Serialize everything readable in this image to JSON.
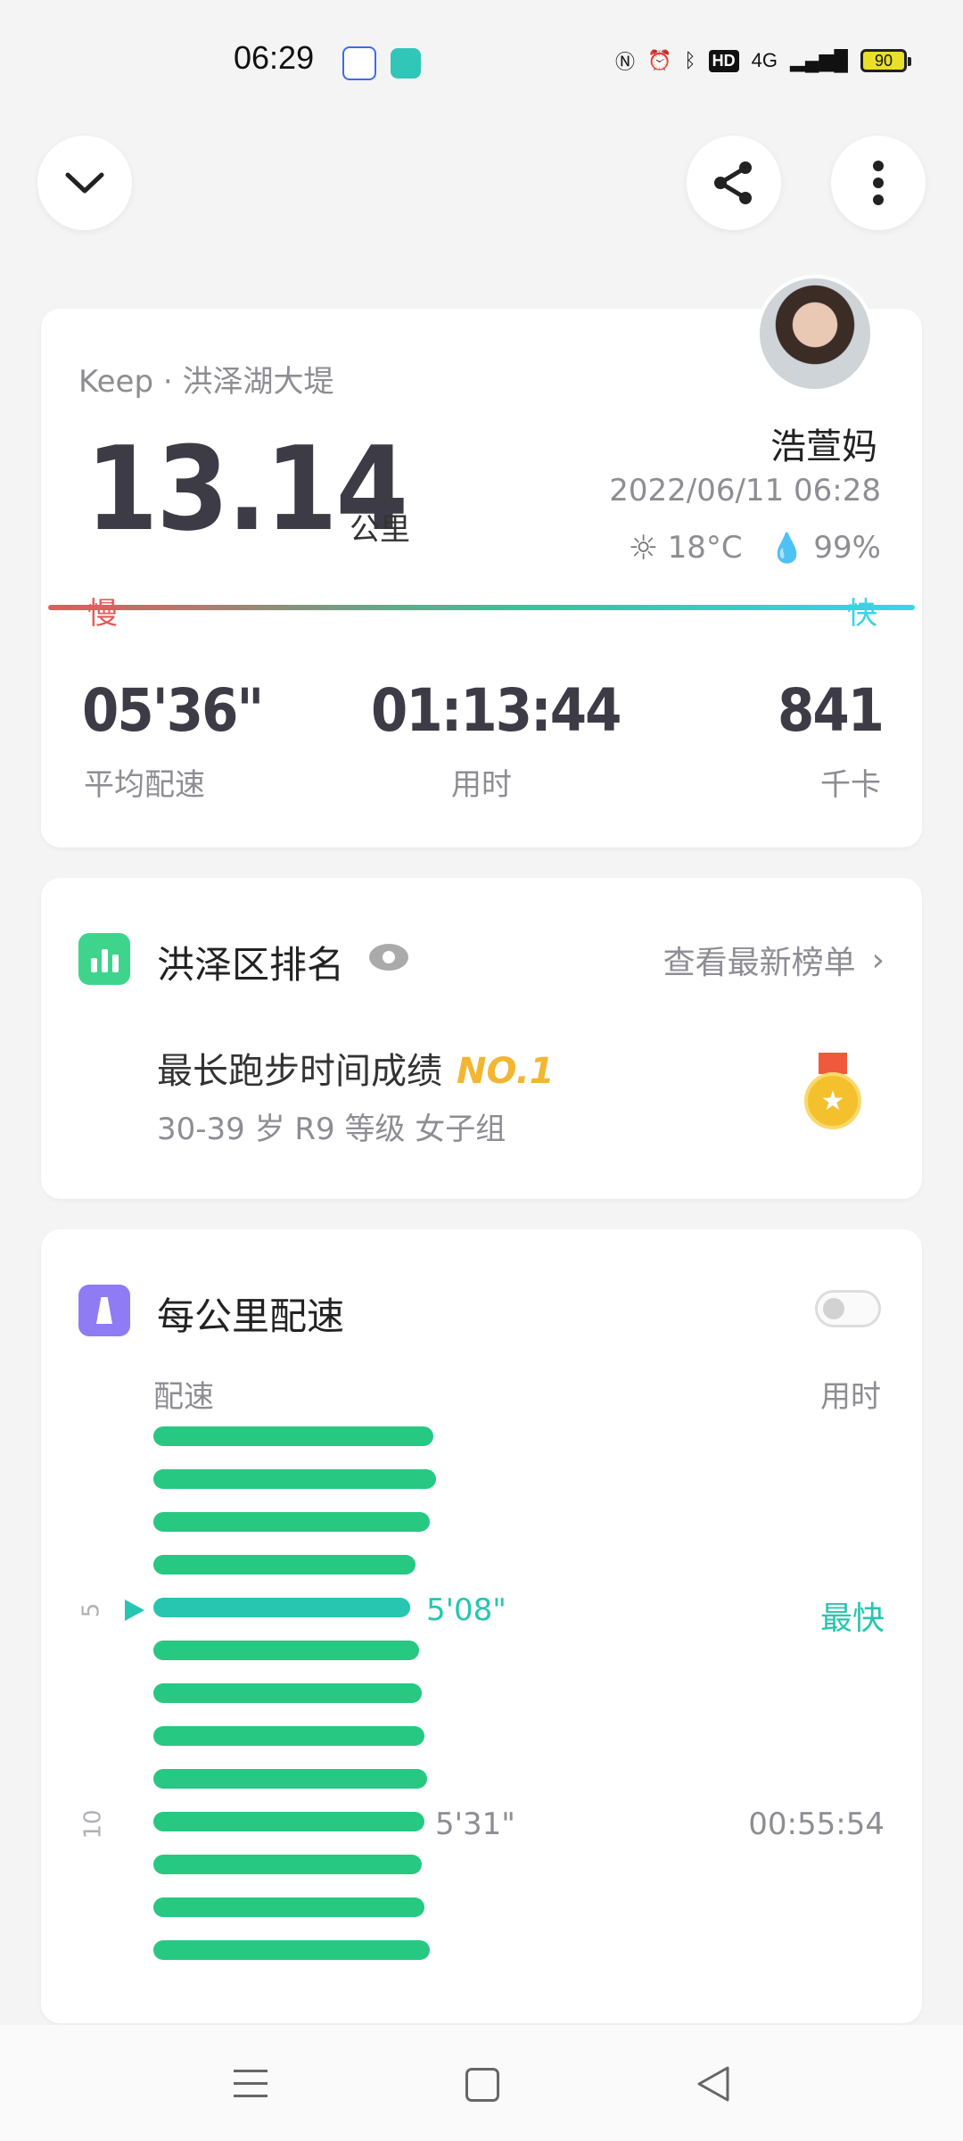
{
  "status_bar": {
    "time": "06:29",
    "network": "4G",
    "battery": "90"
  },
  "summary": {
    "source": "Keep · 洪泽湖大堤",
    "distance": "13.14",
    "distance_unit": "公里",
    "user_name": "浩萱妈",
    "datetime": "2022/06/11 06:28",
    "temperature": "18°C",
    "humidity": "99%",
    "slow_label": "慢",
    "fast_label": "快",
    "stats": [
      {
        "value": "05'36\"",
        "label": "平均配速"
      },
      {
        "value": "01:13:44",
        "label": "用时"
      },
      {
        "value": "841",
        "label": "千卡"
      }
    ]
  },
  "ranking": {
    "title": "洪泽区排名",
    "link": "查看最新榜单",
    "achievement": "最长跑步时间成绩",
    "rank": "NO.1",
    "group": "30-39 岁 R9 等级 女子组"
  },
  "pace": {
    "title": "每公里配速",
    "col_pace": "配速",
    "col_time": "用时",
    "marker_5": "5",
    "marker_10": "10",
    "fastest_value": "5'08\"",
    "fastest_label": "最快",
    "km10_value": "5'31\"",
    "km10_time": "00:55:54"
  },
  "chart_data": {
    "type": "bar",
    "orientation": "horizontal",
    "categories": [
      "1",
      "2",
      "3",
      "4",
      "5",
      "6",
      "7",
      "8",
      "9",
      "10",
      "11",
      "12",
      "13"
    ],
    "values": [
      0.98,
      0.99,
      0.97,
      0.92,
      0.9,
      0.93,
      0.94,
      0.95,
      0.96,
      0.95,
      0.94,
      0.95,
      0.97
    ],
    "highlight_index": 4,
    "colors": {
      "normal": "#27c881",
      "fastest": "#26c6b0"
    }
  }
}
